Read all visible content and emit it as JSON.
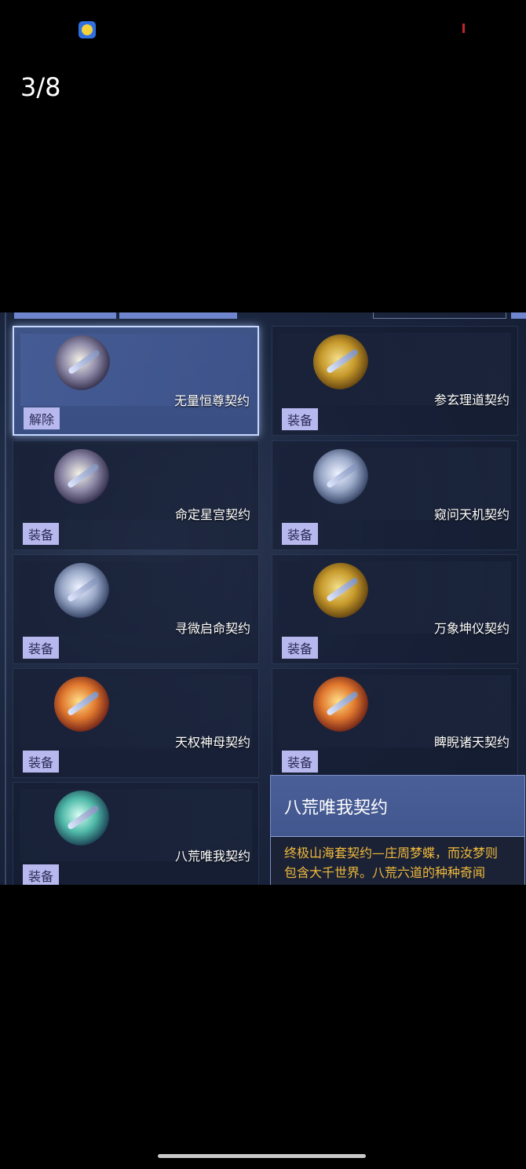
{
  "status_bar": {
    "app_icon": "qq-bubble-icon"
  },
  "viewer": {
    "page_counter": "3/8"
  },
  "cards": [
    {
      "title": "无量恒尊契约",
      "action": "解除",
      "selected": true,
      "emblem": "mixed"
    },
    {
      "title": "参玄理道契约",
      "action": "装备",
      "selected": false,
      "emblem": "gold"
    },
    {
      "title": "命定星宫契约",
      "action": "装备",
      "selected": false,
      "emblem": "mixed"
    },
    {
      "title": "窥问天机契约",
      "action": "装备",
      "selected": false,
      "emblem": "silver"
    },
    {
      "title": "寻微启命契约",
      "action": "装备",
      "selected": false,
      "emblem": "silver"
    },
    {
      "title": "万象坤仪契约",
      "action": "装备",
      "selected": false,
      "emblem": "gold"
    },
    {
      "title": "天权神母契约",
      "action": "装备",
      "selected": false,
      "emblem": "fire"
    },
    {
      "title": "睥睨诸天契约",
      "action": "装备",
      "selected": false,
      "emblem": "fire"
    },
    {
      "title": "八荒唯我契约",
      "action": "装备",
      "selected": false,
      "emblem": "teal"
    }
  ],
  "tooltip": {
    "title": "八荒唯我契约",
    "description_line1": "终极山海套契约—庄周梦蝶，而汝梦则",
    "description_line2": "包含大千世界。八荒六道的种种奇闻"
  },
  "colors": {
    "selected_card": "#3e5386",
    "equip_button": "#b7b8ee",
    "tooltip_text": "#f0b93a",
    "tab_bar": "#6f86cf"
  }
}
